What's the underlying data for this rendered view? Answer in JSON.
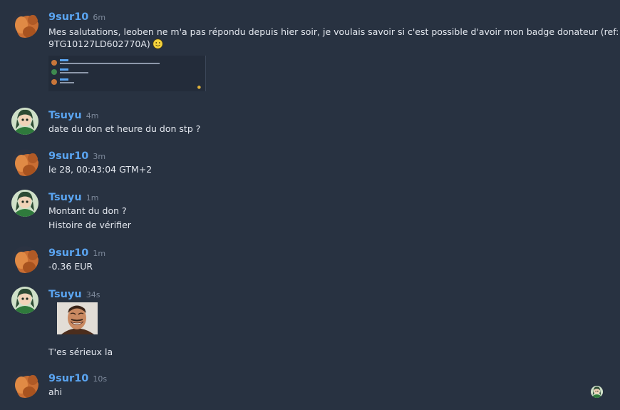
{
  "users": {
    "a": "9sur10",
    "b": "Tsuyu"
  },
  "messages": [
    {
      "author": "9sur10",
      "time": "6m",
      "lines": [
        "Mes salutations, leoben ne m'a pas répondu depuis hier soir, je voulais savoir si c'est possible d'avoir mon badge donateur (ref:",
        "9TG10127LD602770A)"
      ],
      "attachment": "screenshot-thumbnail",
      "emoji": "slightly-smiling-emoji"
    },
    {
      "author": "Tsuyu",
      "time": "4m",
      "lines": [
        "date du don et heure du don stp ?"
      ]
    },
    {
      "author": "9sur10",
      "time": "3m",
      "lines": [
        "le 28, 00:43:04 GTM+2"
      ]
    },
    {
      "author": "Tsuyu",
      "time": "1m",
      "lines": [
        "Montant du don ?",
        "Histoire de vérifier"
      ]
    },
    {
      "author": "9sur10",
      "time": "1m",
      "lines": [
        "-0.36 EUR"
      ]
    },
    {
      "author": "Tsuyu",
      "time": "34s",
      "attachment": "laughing-man-meme",
      "lines": [
        "T'es sérieux la"
      ]
    },
    {
      "author": "9sur10",
      "time": "10s",
      "lines": [
        "ahi"
      ]
    }
  ],
  "colors": {
    "background": "#283241",
    "username": "#5aa4f0",
    "timestamp": "#7e8a9c",
    "text": "#e4e8ef"
  },
  "icons": {
    "avatar_9sur10": "orange-character-avatar",
    "avatar_tsuyu": "green-character-avatar",
    "read_receipt": "read-receipt-avatar-icon"
  }
}
